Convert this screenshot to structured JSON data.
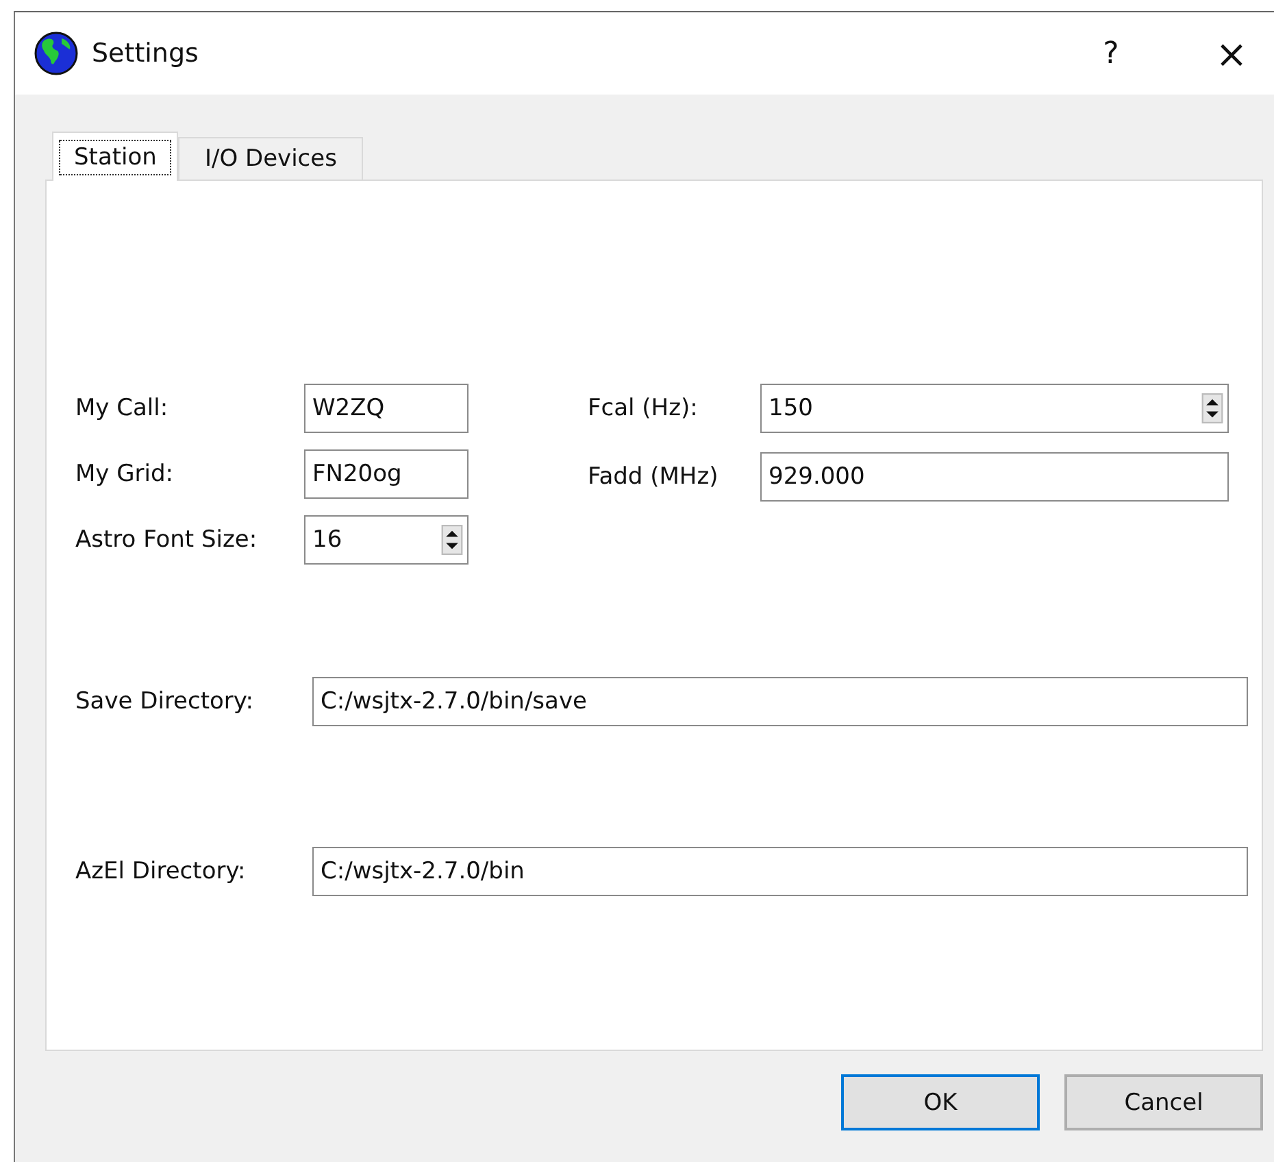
{
  "window": {
    "title": "Settings",
    "help": "?",
    "close": "×"
  },
  "tabs": [
    {
      "label": "Station",
      "selected": true
    },
    {
      "label": "I/O Devices",
      "selected": false
    }
  ],
  "left_fields": [
    {
      "label": "My Call:",
      "value": "W2ZQ",
      "kind": "text"
    },
    {
      "label": "My Grid:",
      "value": "FN20og",
      "kind": "text"
    },
    {
      "label": "Astro Font Size:",
      "value": "16",
      "kind": "spin"
    }
  ],
  "right_fields": [
    {
      "label": "Fcal (Hz):",
      "value": "150",
      "kind": "spin"
    },
    {
      "label": "Fadd (MHz)",
      "value": "929.000",
      "kind": "text"
    }
  ],
  "directories": [
    {
      "label": "Save Directory:",
      "value": "C:/wsjtx-2.7.0/bin/save"
    },
    {
      "label": "AzEl Directory:",
      "value": "C:/wsjtx-2.7.0/bin"
    }
  ],
  "buttons": [
    {
      "label": "OK",
      "default": true
    },
    {
      "label": "Cancel",
      "default": false
    }
  ]
}
